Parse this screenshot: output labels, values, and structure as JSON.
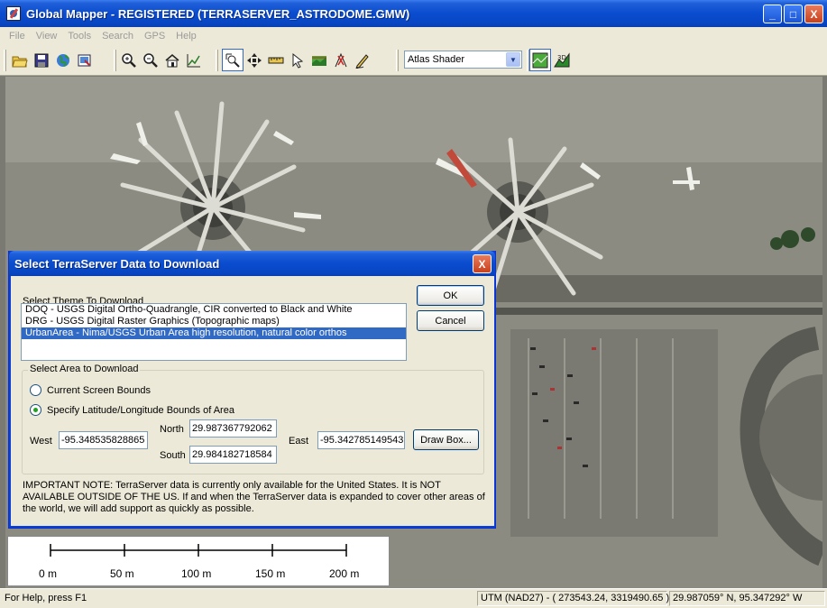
{
  "window": {
    "title": "Global Mapper - REGISTERED (TERRASERVER_ASTRODOME.GMW)",
    "buttons": {
      "minimize": "_",
      "maximize": "□",
      "close": "X"
    }
  },
  "menubar": [
    "File",
    "View",
    "Tools",
    "Search",
    "GPS",
    "Help"
  ],
  "toolbar": {
    "buttons": [
      {
        "name": "open-icon"
      },
      {
        "name": "save-icon"
      },
      {
        "name": "globe-icon"
      },
      {
        "name": "export-icon"
      },
      {
        "name": "zoom-in-icon"
      },
      {
        "name": "zoom-out-icon"
      },
      {
        "name": "home-icon"
      },
      {
        "name": "profile-icon"
      },
      {
        "name": "zoom-tool-icon"
      },
      {
        "name": "pan-icon"
      },
      {
        "name": "measure-icon"
      },
      {
        "name": "pointer-icon"
      },
      {
        "name": "view-shed-icon"
      },
      {
        "name": "path-icon"
      },
      {
        "name": "digitizer-icon"
      }
    ],
    "shader": "Atlas Shader",
    "view_2d": "2D",
    "view_3d": "3D"
  },
  "scalebar": {
    "labels": [
      "0 m",
      "50 m",
      "100 m",
      "150 m",
      "200 m"
    ]
  },
  "statusbar": {
    "help": "For Help, press F1",
    "utm": "UTM (NAD27) - ( 273543.24, 3319490.65 )",
    "latlon": "29.987059° N, 95.347292° W"
  },
  "dialog": {
    "title": "Select TerraServer Data to Download",
    "close": "X",
    "theme_group_label": "Select Theme To Download",
    "themes": [
      "DOQ - USGS Digital Ortho-Quadrangle, CIR converted to Black and White",
      "DRG - USGS Digital Raster Graphics (Topographic maps)",
      "UrbanArea - Nima/USGS Urban Area high resolution, natural color orthos"
    ],
    "selected_theme_index": 2,
    "ok": "OK",
    "cancel": "Cancel",
    "area_group_label": "Select Area to Download",
    "radio_screen": "Current Screen Bounds",
    "radio_latlon": "Specify Latitude/Longitude Bounds of Area",
    "north_label": "North",
    "north_value": "29.987367792062",
    "south_label": "South",
    "south_value": "29.984182718584",
    "west_label": "West",
    "west_value": "-95.348535828865",
    "east_label": "East",
    "east_value": "-95.342785149543",
    "draw_box": "Draw Box...",
    "note": "IMPORTANT NOTE: TerraServer data is currently only available for the United States. It is NOT AVAILABLE OUTSIDE OF THE US. If and when the TerraServer data is expanded to cover other areas of the world, we will add support as quickly as possible."
  },
  "colors": {
    "titlebar": "#0a4ccf",
    "selection": "#316ac5",
    "face": "#ece9d8"
  }
}
